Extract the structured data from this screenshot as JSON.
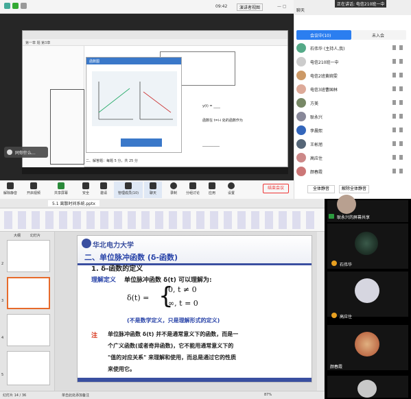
{
  "top_title": {
    "time": "09:42",
    "presenter": "演讲者视图",
    "mode": "聊天",
    "banner": "正在讲话: 电信210班一中"
  },
  "toolbar": {
    "items": [
      "解除静音",
      "开启视频",
      "共享屏幕",
      "安全",
      "邀请",
      "管理成员(10)",
      "聊天",
      "录制",
      "分组讨论",
      "应用",
      "设置"
    ],
    "leave": "结束会议"
  },
  "overlay_label": "同你什么...",
  "right_panel": {
    "tab_active": "会议中(10)",
    "tab_other": "未入会",
    "members": [
      "石伟华\n(主持人,我)",
      "电信210班一中",
      "电信2班黄婉雯",
      "电信3班曹国林",
      "方美",
      "耿永兴",
      "李晨熙",
      "王彬旭",
      "高应住",
      "颜春霞"
    ],
    "footer": [
      "全体静音",
      "解除全体静音"
    ]
  },
  "inner_doc": {
    "title": "第一章 题  第3章",
    "pane_title": "函数图",
    "lines": [
      "y(t) = ____",
      "函数在 t=i-i 处的函数作为",
      "__________"
    ],
    "footer": "二、解答题：每题 5 分，共 25 分"
  },
  "ppt": {
    "tab": "5.1 离散时间系统.pptx",
    "panel_tabs": [
      "大纲",
      "幻灯片"
    ],
    "slide_nums": [
      "2",
      "3",
      "4",
      "5"
    ],
    "status_left": "幻灯片 14 / 36",
    "status_mid": "单击此处添加备注",
    "zoom": "87%"
  },
  "slide": {
    "logo": "华北电力大学",
    "heading": "二、单位脉冲函数 (δ-函数)",
    "sub": "1. δ-函数的定义",
    "line1a": "理解定义",
    "line1b": "单位脉冲函数 δ(t) 可以理解为:",
    "formula_lhs": "δ(t) =",
    "case1": "0,   t ≠ 0",
    "case2": "∞,   t = 0",
    "note": "(不是数学定义，只是理解形式的定义)",
    "zhu": "注",
    "para1": "单位脉冲函数 δ(t) 并不是通常意义下的函数，而是一",
    "para2": "个广义函数(或者奇异函数)，它不能用通常意义下的",
    "para3": "\"值的对应关系\" 来理解和使用，而总是通过它的性质",
    "para4": "来使用它。"
  },
  "video": {
    "names": [
      "耿永兴的屏幕共享",
      "石伟华",
      "高应住",
      "颜春霞"
    ]
  }
}
